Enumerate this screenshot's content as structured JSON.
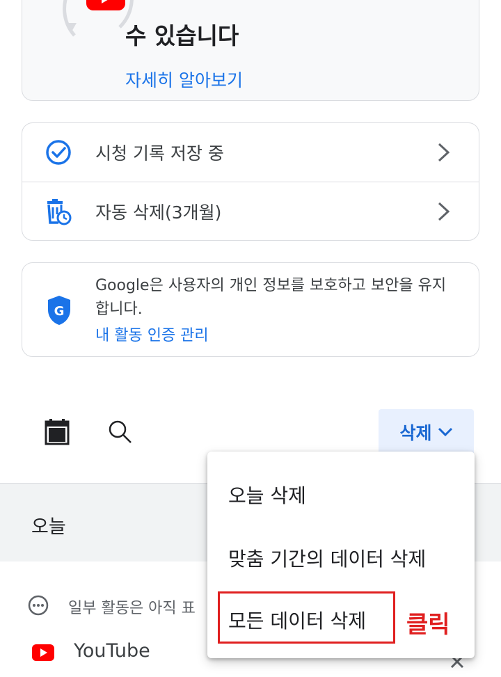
{
  "top_card": {
    "title": "수 있습니다",
    "learn_more": "자세히 알아보기"
  },
  "settings": [
    {
      "label": "시청 기록 저장 중",
      "icon": "check-circle-icon"
    },
    {
      "label": "자동 삭제(3개월)",
      "icon": "auto-delete-icon"
    }
  ],
  "privacy": {
    "text": "Google은 사용자의 개인 정보를 보호하고 보안을 유지합니다.",
    "link": "내 활동 인증 관리",
    "icon": "google-shield-icon"
  },
  "toolbar": {
    "delete_label": "삭제",
    "icons": [
      "calendar-icon",
      "search-icon",
      "chevron-down-icon"
    ]
  },
  "section": {
    "today": "오늘",
    "pending_text": "일부 활동은 아직 표",
    "app_name": "YouTube"
  },
  "menu": {
    "items": [
      "오늘 삭제",
      "맞춤 기간의 데이터 삭제",
      "모든 데이터 삭제"
    ]
  },
  "annotation": {
    "click_label": "클릭"
  },
  "colors": {
    "accent": "#1a73e8",
    "youtube_red": "#ff0000",
    "annotation_red": "#e02020"
  }
}
